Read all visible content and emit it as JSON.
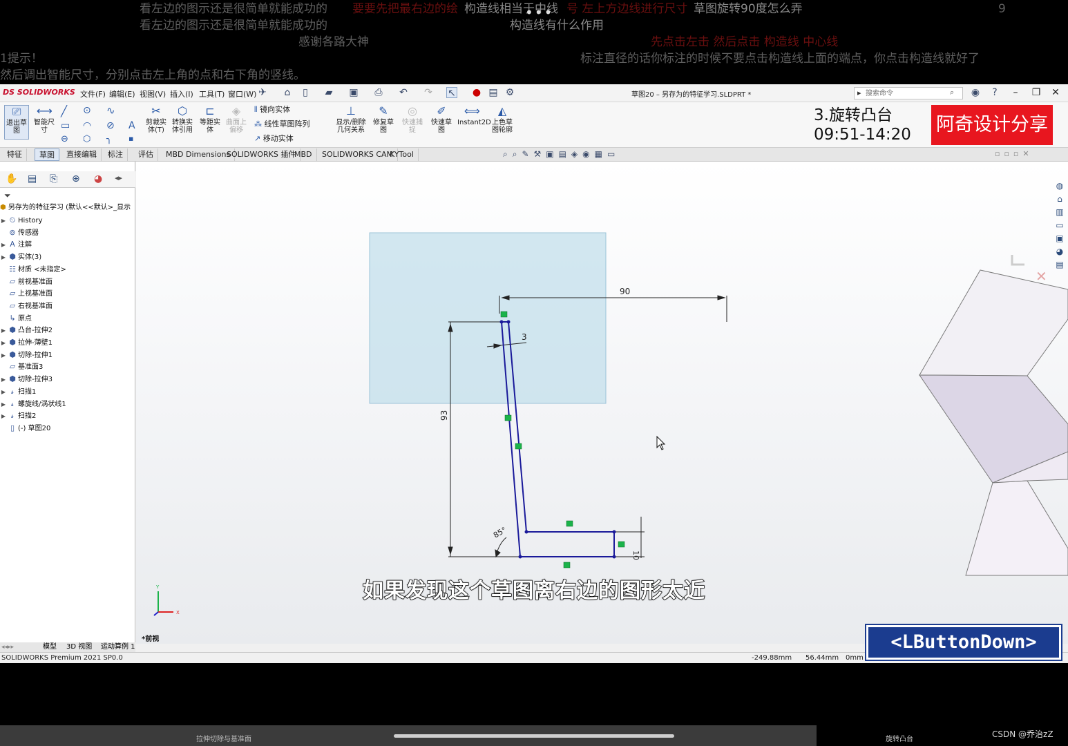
{
  "danmaku": [
    {
      "text": "看左边的图示还是很简单就能成功的",
      "style": "g"
    },
    {
      "text": "要要先把最右边的绘",
      "style": "r"
    },
    {
      "text": "构造线相当于中线",
      "style": "g"
    },
    {
      "text": "号 左上方边线进行尺寸",
      "style": "r"
    },
    {
      "text": "草图旋转90度怎么弄",
      "style": "g"
    },
    {
      "text": "9",
      "style": "g"
    },
    {
      "text": "看左边的图示还是很简单就能成功的",
      "style": "g"
    },
    {
      "text": "构造线有什么作用",
      "style": "g"
    },
    {
      "text": "感谢各路大神",
      "style": "g"
    },
    {
      "text": "先点击左击  然后点击  构造线 中心线",
      "style": "r"
    },
    {
      "text": "1提示！",
      "style": "g"
    },
    {
      "text": "标注直径的话你标注的时候不要点击构造线上面的端点，你点击构造线就好了",
      "style": "g"
    },
    {
      "text": "然后调出智能尺寸，分别点击左上角的点和右下角的竖线。",
      "style": "g"
    }
  ],
  "titlebar": {
    "logo": "DS SOLIDWORKS",
    "menus": [
      "文件(F)",
      "编辑(E)",
      "视图(V)",
      "插入(I)",
      "工具(T)",
      "窗口(W)"
    ],
    "doc_title": "草图20 – 另存为的特征学习.SLDPRT *",
    "search_placeholder": "搜索命令"
  },
  "ribbon": {
    "big": [
      {
        "id": "exit-sketch",
        "label": "退出草图"
      },
      {
        "id": "smart-dim",
        "label": "智能尺寸"
      },
      {
        "id": "trim",
        "label": "剪裁实体(T)"
      },
      {
        "id": "convert",
        "label": "转换实体引用"
      },
      {
        "id": "offset",
        "label": "等距实体"
      },
      {
        "id": "surface-offset",
        "label": "曲面上偏移"
      },
      {
        "id": "display-relations",
        "label": "显示/删除几何关系"
      },
      {
        "id": "repair",
        "label": "修复草图"
      },
      {
        "id": "quick-snap",
        "label": "快速捕捉"
      },
      {
        "id": "rapid-sketch",
        "label": "快速草图"
      },
      {
        "id": "instant2d",
        "label": "Instant2D"
      },
      {
        "id": "shaded-contour",
        "label": "上色草图轮廓"
      }
    ],
    "small": [
      "镜向实体",
      "线性草图阵列",
      "移动实体"
    ]
  },
  "overlay": {
    "title": "3.旋转凸台",
    "time": "09:51-14:20",
    "brand": "阿奇设计分享"
  },
  "cmtabs": [
    "特征",
    "草图",
    "直接编辑",
    "标注",
    "评估",
    "MBD Dimensions",
    "SOLIDWORKS 插件",
    "MBD",
    "SOLIDWORKS CAM",
    "KYTool"
  ],
  "active_tab": "草图",
  "tree": {
    "root": "另存为的特征学习 (默认<<默认>_显示",
    "items": [
      {
        "label": "History",
        "arrow": true
      },
      {
        "label": "传感器",
        "arrow": false
      },
      {
        "label": "注解",
        "arrow": true
      },
      {
        "label": "实体(3)",
        "arrow": true
      },
      {
        "label": "材质 <未指定>",
        "arrow": false
      },
      {
        "label": "前视基准面",
        "arrow": false
      },
      {
        "label": "上视基准面",
        "arrow": false
      },
      {
        "label": "右视基准面",
        "arrow": false
      },
      {
        "label": "原点",
        "arrow": false
      },
      {
        "label": "凸台-拉伸2",
        "arrow": true
      },
      {
        "label": "拉伸-薄壁1",
        "arrow": true
      },
      {
        "label": "切除-拉伸1",
        "arrow": true
      },
      {
        "label": "基准面3",
        "arrow": false
      },
      {
        "label": "切除-拉伸3",
        "arrow": true
      },
      {
        "label": "扫描1",
        "arrow": true
      },
      {
        "label": "螺旋线/涡状线1",
        "arrow": true
      },
      {
        "label": "扫描2",
        "arrow": true
      },
      {
        "label": "(-) 草图20",
        "arrow": false
      }
    ]
  },
  "model_tabs": [
    "模型",
    "3D 视图",
    "运动算例 1"
  ],
  "view_label": "*前视",
  "dims": {
    "d90": "90",
    "d3": "3",
    "d93": "93",
    "d85": "85°",
    "d10": "10"
  },
  "subtitle": "如果发现这个草图离右边的图形太近",
  "lbuttondown": "<LButtonDown>",
  "status": {
    "app": "SOLIDWORKS Premium 2021 SP0.0",
    "x": "-249.88mm",
    "y": "56.44mm",
    "z": "0mm"
  },
  "bottom": {
    "left": "拉伸切除与基准面",
    "right": "旋转凸台",
    "credit": "CSDN @乔治zZ"
  },
  "colors": {
    "sketch": "#1a1a9a",
    "plane": "#bcdcea",
    "brand": "#e8161f",
    "relation": "#1bb34a",
    "lbd": "#1b3c8f"
  }
}
